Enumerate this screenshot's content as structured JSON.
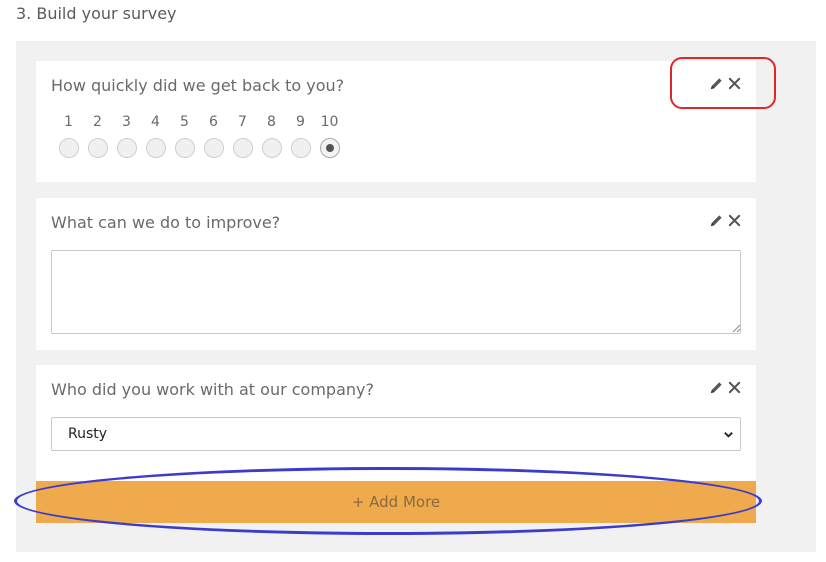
{
  "section": {
    "title": "3. Build your survey"
  },
  "questions": [
    {
      "label": "How quickly did we get back to you?",
      "type": "scale",
      "options": [
        "1",
        "2",
        "3",
        "4",
        "5",
        "6",
        "7",
        "8",
        "9",
        "10"
      ],
      "selected": "10"
    },
    {
      "label": "What can we do to improve?",
      "type": "textarea",
      "value": ""
    },
    {
      "label": "Who did you work with at our company?",
      "type": "select",
      "selected": "Rusty"
    }
  ],
  "add_more": {
    "label": "+ Add More"
  },
  "icons": {
    "edit": "pencil-icon",
    "delete": "close-icon",
    "dropdown": "chevron-down-icon"
  },
  "colors": {
    "accent": "#eeaa4d",
    "highlight_red": "#e0262a",
    "highlight_blue": "#3c3ccc"
  }
}
